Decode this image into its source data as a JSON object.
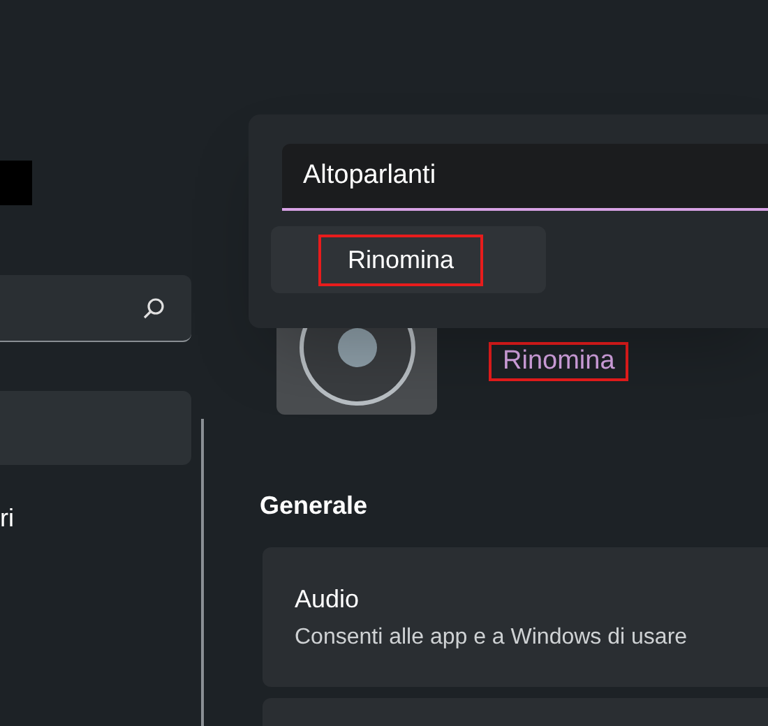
{
  "sidebar": {
    "items": [
      {
        "selected": true
      },
      {
        "label": "ri",
        "selected": false
      }
    ]
  },
  "rename_dialog": {
    "value": "Altoparlanti",
    "options": [
      {
        "label": "Rinomina",
        "highlighted": true
      }
    ]
  },
  "device": {
    "link": "Rinomina",
    "link_highlighted": true
  },
  "section": {
    "title": "Generale"
  },
  "cards": [
    {
      "title": "Audio",
      "description": "Consenti alle app e a Windows di usare"
    }
  ]
}
